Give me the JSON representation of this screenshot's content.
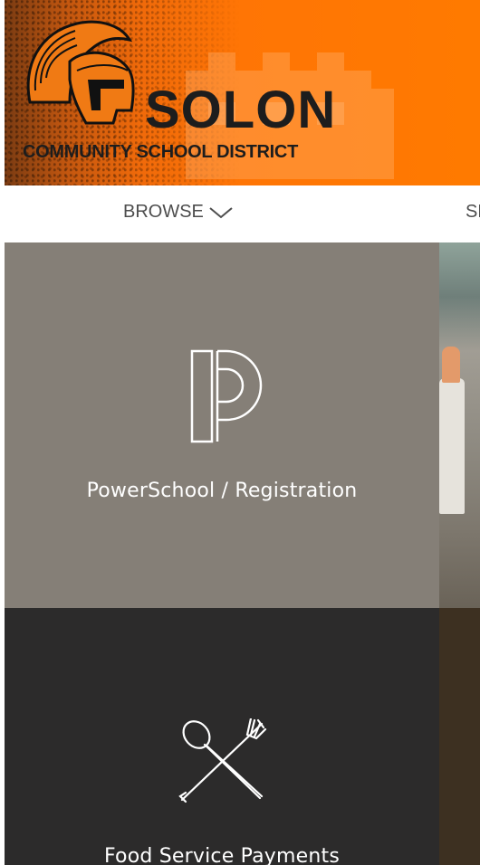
{
  "header": {
    "logo_title": "SOLON",
    "logo_subtitle": "COMMUNITY SCHOOL DISTRICT"
  },
  "nav": {
    "browse_label": "BROWSE",
    "next_label_partial": "SE"
  },
  "tiles": [
    {
      "label": "PowerSchool / Registration",
      "icon": "powerschool-p-icon"
    },
    {
      "label": "Food Service Payments",
      "icon": "spoon-fork-icon"
    }
  ],
  "colors": {
    "header_orange": "#ff7505",
    "tile_powerschool_bg": "#857f77",
    "tile_food_bg": "#2c2b2b",
    "nav_text": "#4d4d4d"
  }
}
